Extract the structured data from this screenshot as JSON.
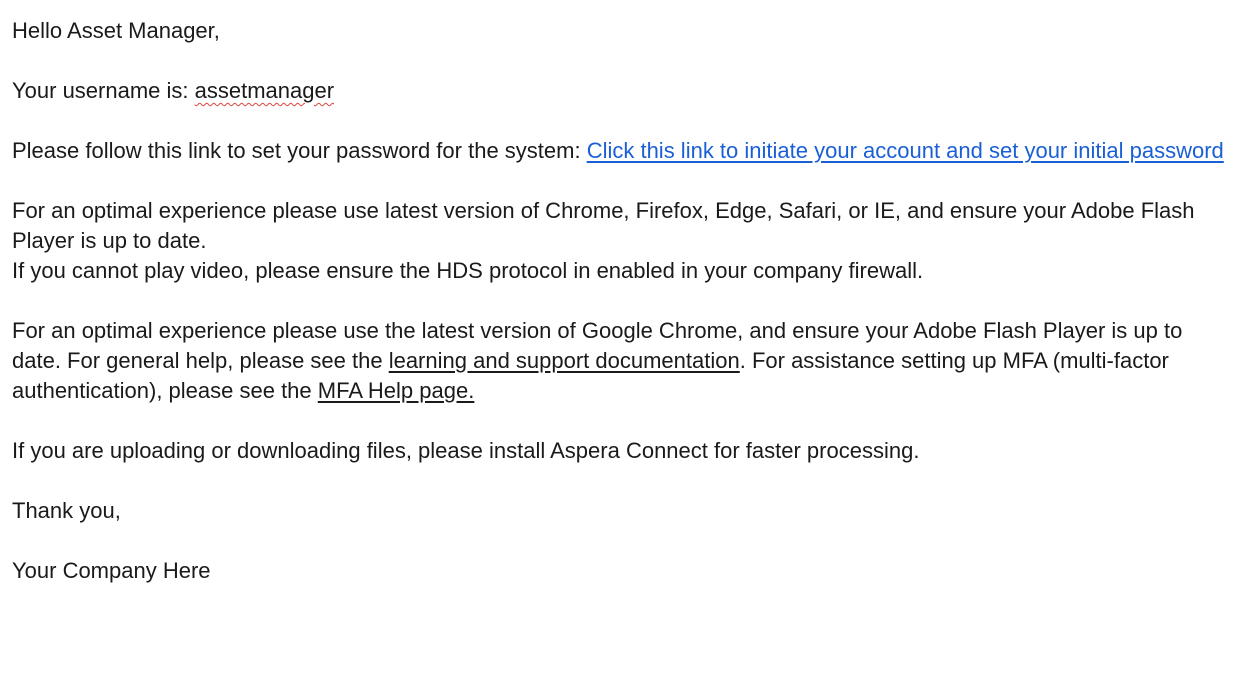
{
  "email": {
    "greeting": "Hello Asset Manager,",
    "username_prefix": "Your username is: ",
    "username": "assetmanager",
    "password_text": "Please follow this link to set your password for the system: ",
    "password_link": "Click this link to initiate your account and set your initial password",
    "browser_line1": "For an optimal experience please use latest version of Chrome, Firefox, Edge, Safari, or IE, and ensure your Adobe Flash Player is up to date.",
    "browser_line2": "If you cannot play video, please ensure the HDS protocol in enabled in your company firewall.",
    "help_part1": "For an optimal experience please use the latest version of Google Chrome, and ensure your Adobe Flash Player is up to date. For general help, please see the ",
    "help_link1": "learning and support documentation",
    "help_part2": ". For assistance setting up MFA (multi-factor authentication), please see the ",
    "help_link2": "MFA Help page.",
    "aspera_line": "If you are uploading or downloading files, please install Aspera Connect for faster processing.",
    "closing": "Thank you,",
    "signature": "Your Company Here"
  }
}
